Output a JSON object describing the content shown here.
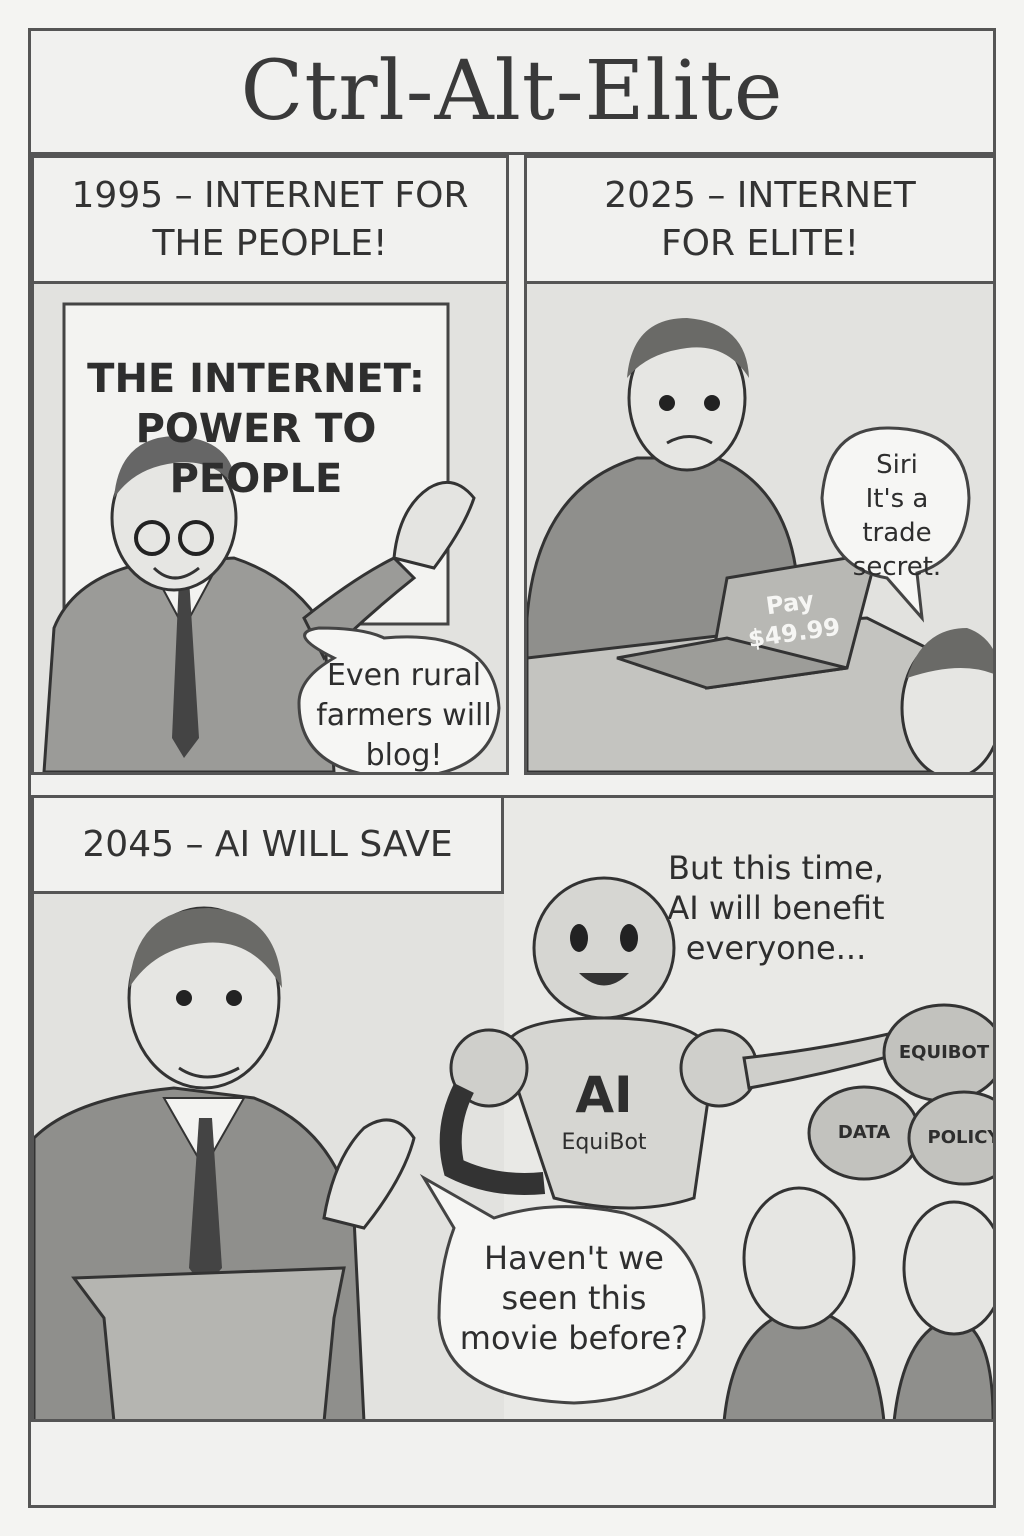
{
  "comic": {
    "title": "Ctrl-Alt-Elite"
  },
  "panels": [
    {
      "caption": "1995 – INTERNET FOR\nTHE PEOPLE!",
      "poster_text": "THE INTERNET:\nPOWER TO\nPEOPLE",
      "speech": "Even rural\nfarmers will\nblog!"
    },
    {
      "caption": "2025 – INTERNET\nFOR ELITE!",
      "laptop_text": "Pay\n$49.99",
      "speech": "Siri\nIt's a\ntrade\nsecret."
    },
    {
      "caption": "2045 – AI WILL SAVE",
      "robot_chest": "AI",
      "robot_name": "EquiBot",
      "robot_speech": "But this time,\nAI will benefit\neveryone...",
      "bags": [
        "EQUIBOT",
        "DATA",
        "POLICY"
      ],
      "audience_speech": "Haven't we\nseen this\nmovie before?"
    }
  ],
  "colors": {
    "ink": "#3a3a3a",
    "paper": "#f1f1ef",
    "shade": "#d7d7d3"
  }
}
